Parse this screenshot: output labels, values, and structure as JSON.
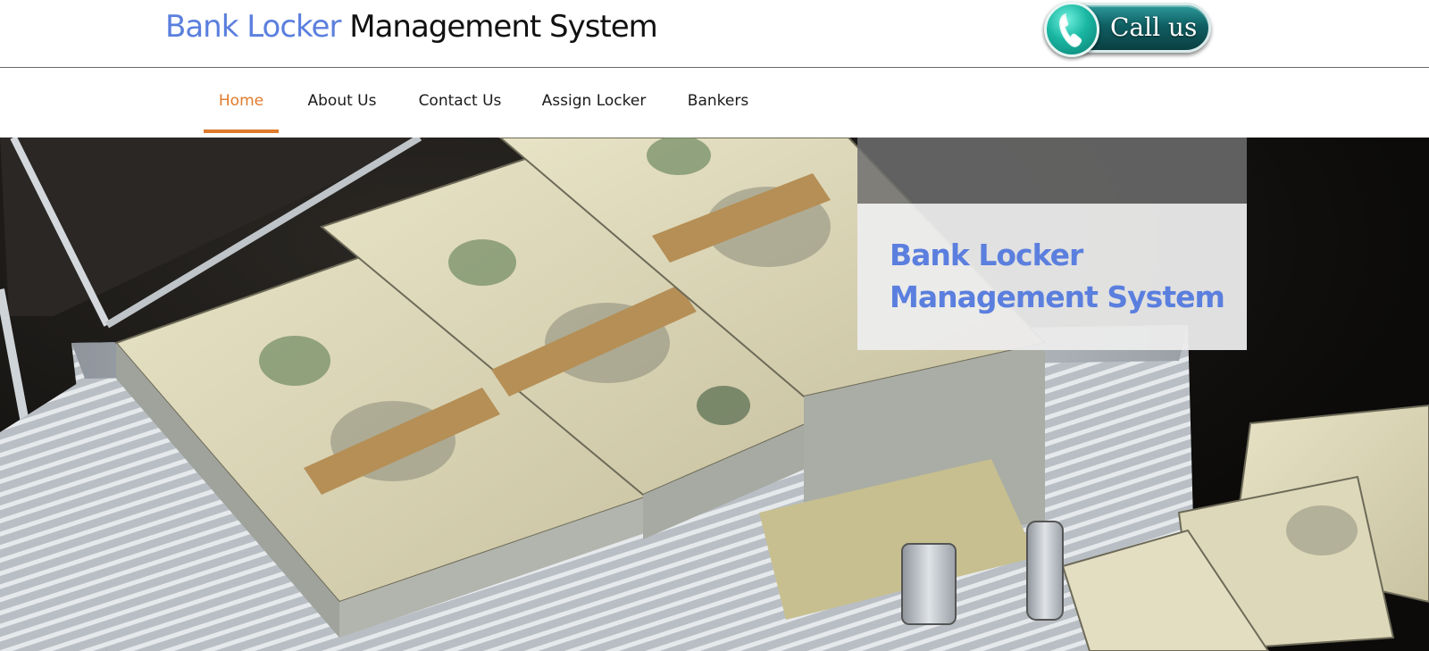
{
  "theme": {
    "accent": "#5b7fde",
    "nav_active": "#e07b2c",
    "call_button_color": "#0f6b6b"
  },
  "header": {
    "title_accent": "Bank Locker",
    "title_rest": "Management System",
    "call_button": {
      "icon": "phone-icon",
      "label": "Call us"
    }
  },
  "nav": {
    "items": [
      {
        "label": "Home",
        "active": true
      },
      {
        "label": "About Us",
        "active": false
      },
      {
        "label": "Contact Us",
        "active": false
      },
      {
        "label": "Assign Locker",
        "active": false
      },
      {
        "label": "Bankers",
        "active": false
      }
    ]
  },
  "hero": {
    "image": "briefcase-of-cash-photo",
    "title_line1": "Bank Locker",
    "title_line2": "Management System"
  }
}
